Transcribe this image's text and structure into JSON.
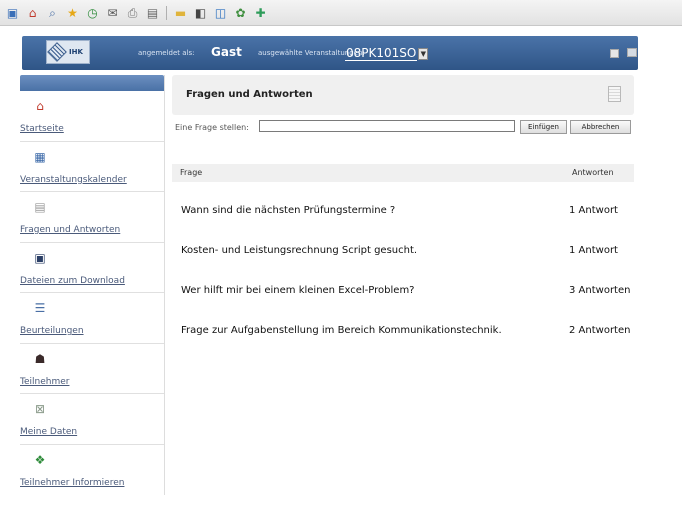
{
  "app": {
    "login_label": "angemeldet als:",
    "user": "Gast",
    "event_label": "ausgewählte Veranstaltungen:",
    "event_value": "08PK101SO",
    "logo_text": "IHK"
  },
  "sidebar": {
    "items": [
      {
        "label": "Startseite",
        "icon": "home-icon"
      },
      {
        "label": "Veranstaltungskalender",
        "icon": "calendar-icon"
      },
      {
        "label": "Fragen und Antworten",
        "icon": "document-icon"
      },
      {
        "label": "Dateien zum Download",
        "icon": "floppy-disk-icon"
      },
      {
        "label": "Beurteilungen",
        "icon": "report-icon"
      },
      {
        "label": "Teilnehmer",
        "icon": "participants-icon"
      },
      {
        "label": "Meine Daten",
        "icon": "profile-icon"
      },
      {
        "label": "Teilnehmer Informieren",
        "icon": "notify-icon"
      }
    ]
  },
  "main": {
    "title": "Fragen und Antworten",
    "ask_label": "Eine Frage stellen:",
    "ask_value": "",
    "insert_label": "Einfügen",
    "cancel_label": "Abbrechen",
    "table": {
      "col_question": "Frage",
      "col_answers": "Antworten",
      "rows": [
        {
          "question": "Wann sind die nächsten Prüfungstermine ?",
          "answers": "1 Antwort"
        },
        {
          "question": "Kosten- und Leistungsrechnung Script gesucht.",
          "answers": "1 Antwort"
        },
        {
          "question": "Wer hilft mir bei einem kleinen Excel-Problem?",
          "answers": "3 Antworten"
        },
        {
          "question": "Frage zur Aufgabenstellung im Bereich Kommunikationstechnik.",
          "answers": "2 Antworten"
        }
      ]
    }
  },
  "colors": {
    "header_bar": "#2f5587",
    "link": "#4a5a7a",
    "panel_bg": "#f0f0f0"
  }
}
